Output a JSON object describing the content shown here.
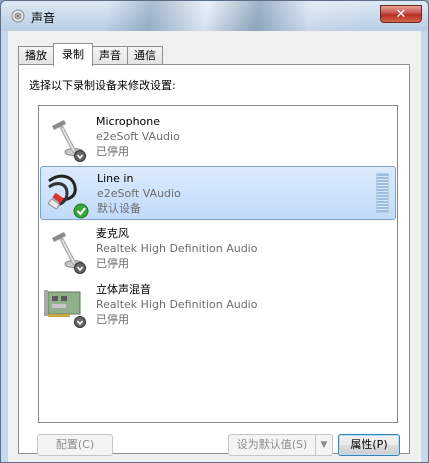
{
  "window": {
    "title": "声音"
  },
  "tabs": [
    {
      "label": "播放",
      "underline": "",
      "rest": "播放",
      "active": false
    },
    {
      "label": "录制",
      "active": true
    },
    {
      "label": "声音",
      "active": false
    },
    {
      "label": "通信",
      "active": false
    }
  ],
  "recording": {
    "instruction": "选择以下录制设备来修改设置:",
    "devices": [
      {
        "name": "Microphone",
        "driver": "e2eSoft VAudio",
        "status": "已停用"
      },
      {
        "name": "Line in",
        "driver": "e2eSoft VAudio",
        "status": "默认设备"
      },
      {
        "name": "麦克风",
        "driver": "Realtek High Definition Audio",
        "status": "已停用"
      },
      {
        "name": "立体声混音",
        "driver": "Realtek High Definition Audio",
        "status": "已停用"
      }
    ]
  },
  "buttons": {
    "configure": "配置(C)",
    "set_default": "设为默认值(S)",
    "properties": "属性(P)"
  },
  "colors": {
    "selection": "#c1dbfc",
    "close_button": "#c75050",
    "check": "#3aa63a"
  }
}
